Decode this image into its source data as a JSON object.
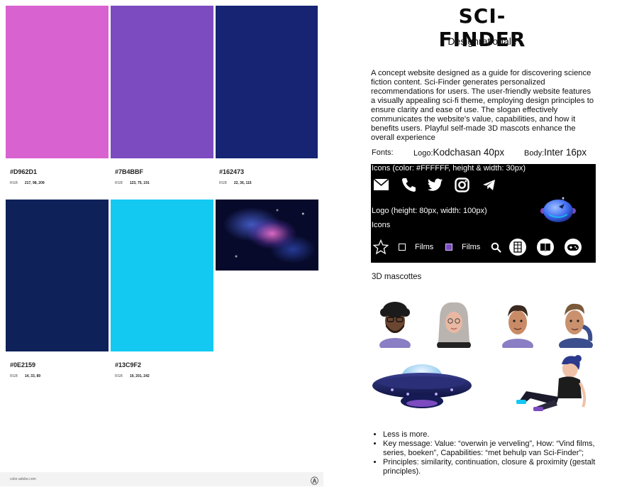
{
  "palette": [
    {
      "color": "#D962D1",
      "hex": "#D962D1",
      "rgb_label": "RGB",
      "rgb": "217, 98, 209"
    },
    {
      "color": "#7B4BBF",
      "hex": "#7B4BBF",
      "rgb_label": "RGB",
      "rgb": "123, 75, 191"
    },
    {
      "color": "#162473",
      "hex": "#162473",
      "rgb_label": "RGB",
      "rgb": "22, 36, 115"
    },
    {
      "color": "#0E2159",
      "hex": "#0E2159",
      "rgb_label": "RGB",
      "rgb": "14, 33, 89"
    },
    {
      "color": "#13C9F2",
      "hex": "#13C9F2",
      "rgb_label": "RGB",
      "rgb": "19, 201, 242"
    }
  ],
  "footer": {
    "source": "color.adobe.com",
    "brand_icon": "adobe-logo-icon"
  },
  "title": "SCI-FINDER",
  "subtitle": "Designrationale",
  "intro": "A concept website designed as a guide for discovering science fiction content. Sci-Finder generates personalized recommendations for users. The user-friendly website features a visually appealing sci-fi theme, employing design principles to ensure clarity and ease of use. The slogan effectively communicates the website's value, capabilities, and how it benefits users. Playful self-made 3D mascots enhance the overall experience",
  "fonts": {
    "label": "Fonts:",
    "logo_label": "Logo:",
    "logo_font": "Kodchasan 40px",
    "body_label": "Body:",
    "body_font": "Inter 16px"
  },
  "panel": {
    "icons_caption": "Icons (color: #FFFFFF, height & width: 30px)",
    "social_icons": [
      "mail-icon",
      "phone-icon",
      "twitter-icon",
      "instagram-icon",
      "telegram-icon"
    ],
    "logo_caption": "Logo (height: 80px, width: 100px)",
    "icons_label": "Icons",
    "films_label_1": "Films",
    "films_label_2": "Films",
    "checkbox_accent": "#7B4BBF",
    "ui_icons": [
      "star-icon",
      "checkbox-empty-icon",
      "checkbox-filled-icon",
      "search-icon",
      "film-icon",
      "book-icon",
      "gamepad-icon"
    ]
  },
  "mascots_label": "3D mascottes",
  "bullets": [
    "Less is more.",
    "Key message: Value: “overwin je verveling”, How: “Vind films, series, boeken”, Capabilities: “met behulp van Sci-Finder”;",
    "Principles: similarity, continuation, closure & proximity (gestalt principles)."
  ]
}
